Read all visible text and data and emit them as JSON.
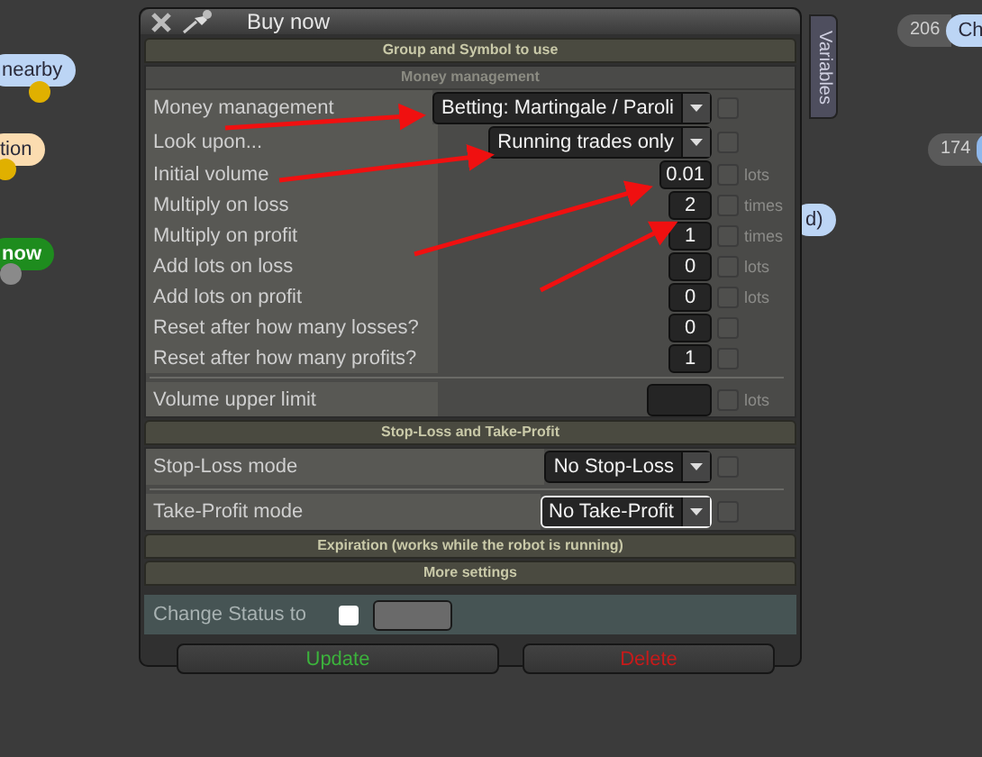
{
  "canvas_nodes": [
    {
      "text": "nearby",
      "color": "#bcd5f5"
    },
    {
      "text": "tion",
      "color": "#fbdcb0"
    },
    {
      "text": "now",
      "color": "#1e8c1e"
    },
    {
      "count": "206",
      "text": "Ch",
      "color": "#bcd5f5"
    },
    {
      "count": "174",
      "color": "#8fb8ec"
    },
    {
      "text": "d)",
      "color": "#bcd5f5"
    }
  ],
  "window": {
    "title": "Buy now",
    "side_tab": "Variables"
  },
  "group_header": "Group and Symbol to use",
  "money_management": {
    "title": "Money management",
    "rows": [
      {
        "kind": "select",
        "label": "Money management",
        "value": "Betting: Martingale / Paroli",
        "focused": false,
        "checked": false
      },
      {
        "kind": "select",
        "label": "Look upon...",
        "value": "Running trades only",
        "focused": false,
        "checked": false
      },
      {
        "kind": "number",
        "label": "Initial volume",
        "value": "0.01",
        "unit": "lots",
        "checked": false
      },
      {
        "kind": "number",
        "label": "Multiply on loss",
        "value": "2",
        "unit": "times",
        "checked": false
      },
      {
        "kind": "number",
        "label": "Multiply on profit",
        "value": "1",
        "unit": "times",
        "checked": false
      },
      {
        "kind": "number",
        "label": "Add lots on loss",
        "value": "0",
        "unit": "lots",
        "checked": false
      },
      {
        "kind": "number",
        "label": "Add lots on profit",
        "value": "0",
        "unit": "lots",
        "checked": false
      },
      {
        "kind": "number",
        "label": "Reset after how many losses?",
        "value": "0",
        "checked": false
      },
      {
        "kind": "number",
        "label": "Reset after how many profits?",
        "value": "1",
        "checked": false
      }
    ],
    "limit": {
      "kind": "number",
      "label": "Volume upper limit",
      "unit": "lots",
      "checked": false
    }
  },
  "sl_tp": {
    "title": "Stop-Loss and Take-Profit",
    "rows": [
      {
        "kind": "select",
        "label": "Stop-Loss mode",
        "value": "No Stop-Loss",
        "focused": false,
        "checked": false
      },
      {
        "kind": "select",
        "label": "Take-Profit mode",
        "value": "No Take-Profit",
        "focused": true,
        "checked": false
      }
    ]
  },
  "collapsed_sections": [
    "Expiration (works while the robot is running)",
    "More settings"
  ],
  "change_status": {
    "label": "Change Status to",
    "checked": false
  },
  "buttons": [
    {
      "label": "Update",
      "kind": "confirm"
    },
    {
      "label": "Delete",
      "kind": "danger"
    }
  ]
}
